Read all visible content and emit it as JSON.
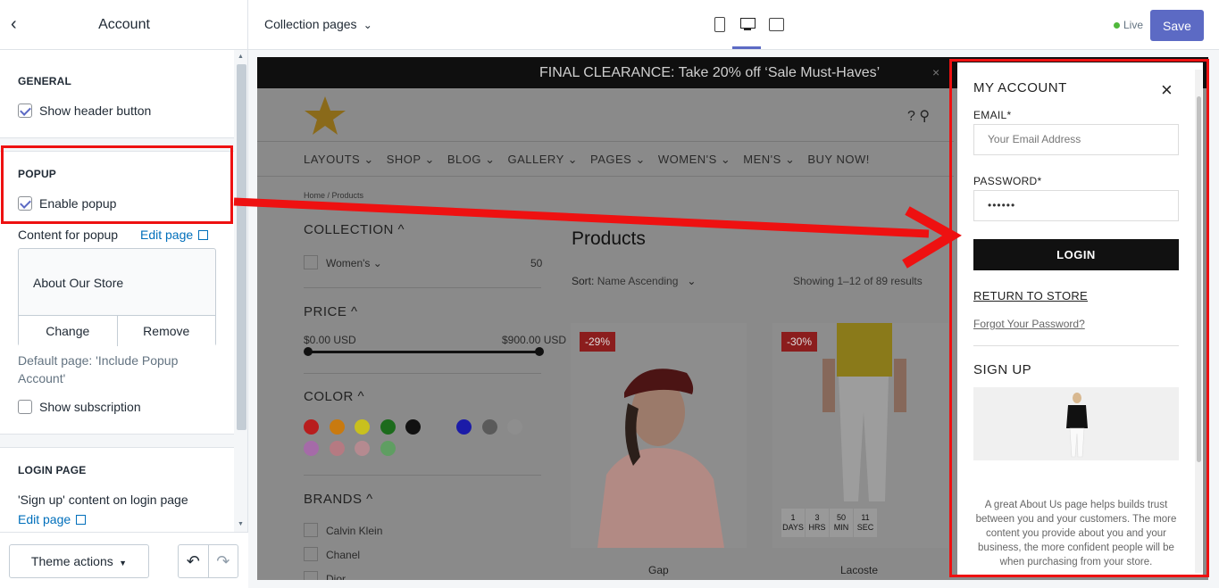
{
  "topbar": {
    "back_glyph": "‹",
    "title": "Account",
    "page_selector": "Collection pages",
    "live_label": "Live",
    "save_label": "Save"
  },
  "sidebar": {
    "general": {
      "title": "GENERAL",
      "show_header_button": "Show header button",
      "show_header_button_checked": true
    },
    "popup": {
      "title": "POPUP",
      "enable_popup": "Enable popup",
      "enable_popup_checked": true,
      "content_label": "Content for popup",
      "edit_page": "Edit page",
      "card_title": "About Our Store",
      "change": "Change",
      "remove": "Remove",
      "default_page": "Default page: 'Include Popup Account'",
      "show_subscription": "Show subscription",
      "show_subscription_checked": false
    },
    "login_page": {
      "title": "LOGIN PAGE",
      "signup_content": "'Sign up' content on login page",
      "edit_page": "Edit page"
    }
  },
  "bottombar": {
    "theme_actions": "Theme actions",
    "undo": "↶",
    "redo": "↷"
  },
  "store": {
    "announcement": "FINAL CLEARANCE: Take 20% off ‘Sale Must-Haves’",
    "announcement_close": "×",
    "header_icons": "?  ⚲",
    "nav": [
      "LAYOUTS ⌄",
      "SHOP ⌄",
      "BLOG ⌄",
      "GALLERY ⌄",
      "PAGES ⌄",
      "WOMEN'S ⌄",
      "MEN'S ⌄",
      "BUY NOW!"
    ],
    "breadcrumb": "Home  /  Products",
    "filters": {
      "collection_title": "COLLECTION ^",
      "collection_item": "Women's ⌄",
      "collection_count": "50",
      "price_title": "PRICE ^",
      "price_min": "$0.00 USD",
      "price_max": "$900.00 USD",
      "color_title": "COLOR ^",
      "colors": [
        "#b81d1d",
        "#c97a0f",
        "#c9c01e",
        "#1c6b1c",
        "#111111",
        "#8a8a8a",
        "#1b1ba8",
        "#5a5a5a",
        "#8e8e8e",
        "#a56ba8",
        "#b57a82",
        "#b58a90",
        "#5f9e62"
      ],
      "brands_title": "BRANDS ^",
      "brands": [
        "Calvin Klein",
        "Chanel",
        "Dior"
      ]
    },
    "products_title": "Products",
    "sort_label": "Sort:",
    "sort_value": "Name Ascending",
    "showing": "Showing 1–12 of 89 results",
    "products": [
      {
        "badge": "-29%",
        "name": "Gap"
      },
      {
        "badge": "-30%",
        "name": "Lacoste"
      }
    ],
    "countdown": [
      {
        "value": "1",
        "unit": "DAYS"
      },
      {
        "value": "3",
        "unit": "HRS"
      },
      {
        "value": "50",
        "unit": "MIN"
      },
      {
        "value": "11",
        "unit": "SEC"
      }
    ]
  },
  "account_popup": {
    "title": "MY ACCOUNT",
    "close": "×",
    "email_label": "EMAIL*",
    "email_placeholder": "Your Email Address",
    "password_label": "PASSWORD*",
    "password_value": "••••••",
    "login": "LOGIN",
    "return_to_store": "RETURN TO STORE",
    "forgot_password": "Forgot Your Password?",
    "signup_title": "SIGN UP",
    "description": "A great About Us page helps builds trust between you and your customers. The more content you provide about you and your business, the more confident people will be when purchasing from your store."
  },
  "annotation": {
    "color": "#ee1111"
  }
}
